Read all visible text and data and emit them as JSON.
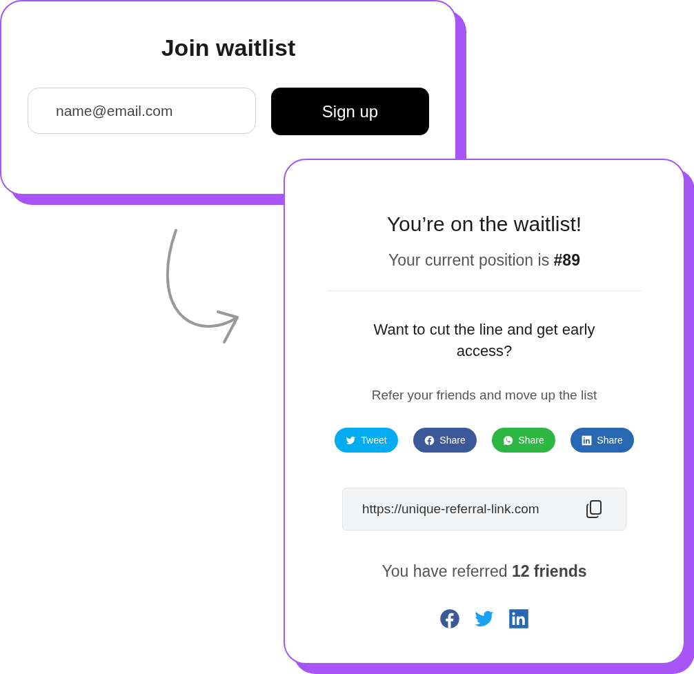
{
  "signup_card": {
    "title": "Join waitlist",
    "email_field": {
      "placeholder": "name@email.com"
    },
    "submit_button": "Sign up"
  },
  "confirmation_card": {
    "title": "You’re on the waitlist!",
    "position": "Your current position is **#89**",
    "prompt": "Want to cut the line and get early access?",
    "subtitle": "Refer your friends and move up the list",
    "share_buttons": [
      {
        "kind": "twitter",
        "label": "Tweet",
        "color": "#03acf0"
      },
      {
        "kind": "facebook",
        "label": "Share",
        "color": "#3b5998"
      },
      {
        "kind": "whatsapp",
        "label": "Share",
        "color": "#2bb742"
      },
      {
        "kind": "linkedin",
        "label": "Share",
        "color": "#2867b2"
      }
    ],
    "referral_link": "https://unique-referral-link.com",
    "referred": "You have referred **12 friends**",
    "social_icons": [
      {
        "kind": "facebook"
      },
      {
        "kind": "twitter"
      },
      {
        "kind": "linkedin"
      }
    ]
  }
}
